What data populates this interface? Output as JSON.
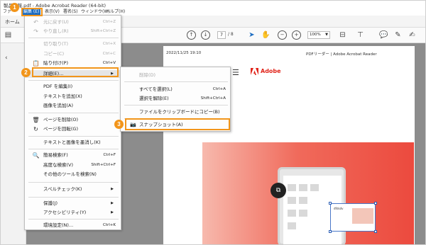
{
  "window": {
    "title": "製品情報.pdf - Adobe Acrobat Reader (64-bit)"
  },
  "menubar": {
    "items": [
      {
        "label": "ファ"
      },
      {
        "label": "編集 (E)"
      },
      {
        "label": "表示(V)"
      },
      {
        "label": "署名(S)"
      },
      {
        "label": "ウィンドウ(W)"
      },
      {
        "label": "ヘルプ(H)"
      }
    ]
  },
  "tabs": {
    "home": "ホーム"
  },
  "toolbar": {
    "page_current": "7",
    "page_total": "/ 8",
    "zoom": "100%"
  },
  "document": {
    "header_date": "2022/11/25 19:10",
    "header_title": "PDFリーダー | Adobe Acrobat Reader",
    "brand": "Adobe",
    "card_text": "dfdsdv"
  },
  "edit_menu": {
    "items": [
      {
        "label": "元に戻す(U)",
        "shortcut": "Ctrl+Z",
        "disabled": true,
        "icon": "undo-icon"
      },
      {
        "label": "やり直し(R)",
        "shortcut": "Shift+Ctrl+Z",
        "disabled": true,
        "icon": "redo-icon"
      },
      {
        "label": "切り取り(T)",
        "shortcut": "Ctrl+X",
        "disabled": true
      },
      {
        "label": "コピー(C)",
        "shortcut": "Ctrl+C",
        "disabled": true
      },
      {
        "label": "貼り付け(P)",
        "shortcut": "Ctrl+V",
        "disabled": false,
        "icon": "clipboard-icon"
      },
      {
        "label": "詳細(E)...",
        "shortcut": "",
        "disabled": false
      },
      {
        "label": "PDF を編集(I)",
        "shortcut": "",
        "disabled": false
      },
      {
        "label": "テキストを追加(X)",
        "shortcut": "",
        "disabled": false
      },
      {
        "label": "画像を追加(A)",
        "shortcut": "",
        "disabled": false
      },
      {
        "label": "ページを削除(O)",
        "shortcut": "",
        "disabled": false,
        "icon": "trash-icon"
      },
      {
        "label": "ページを回転(G)",
        "shortcut": "",
        "disabled": false,
        "icon": "rotate-icon"
      },
      {
        "label": "テキストと画像を墨消し(K)",
        "shortcut": "",
        "disabled": false
      },
      {
        "label": "簡易検索(F)",
        "shortcut": "Ctrl+F",
        "disabled": false,
        "icon": "search-icon"
      },
      {
        "label": "高度な検索(V)",
        "shortcut": "Shift+Ctrl+F",
        "disabled": false
      },
      {
        "label": "その他のツールを検索(N)",
        "shortcut": "",
        "disabled": false
      },
      {
        "label": "スペルチェック(K)",
        "shortcut": "",
        "disabled": false
      },
      {
        "label": "保護(J)",
        "shortcut": "",
        "disabled": false
      },
      {
        "label": "アクセシビリティ(Y)",
        "shortcut": "",
        "disabled": false
      },
      {
        "label": "環境設定(N)...",
        "shortcut": "Ctrl+K",
        "disabled": false
      }
    ]
  },
  "submenu": {
    "items": [
      {
        "label": "削除(D)",
        "shortcut": "",
        "disabled": true
      },
      {
        "label": "すべてを選択(L)",
        "shortcut": "Ctrl+A",
        "disabled": false
      },
      {
        "label": "選択を解除(E)",
        "shortcut": "Shift+Ctrl+A",
        "disabled": false
      },
      {
        "label": "ファイルをクリップボードにコピー(B)",
        "shortcut": "",
        "disabled": false
      },
      {
        "label": "スナップショット(A)",
        "shortcut": "",
        "disabled": false,
        "icon": "camera-icon"
      }
    ]
  },
  "steps": [
    "1",
    "2",
    "3"
  ],
  "colors": {
    "accent_orange": "#f2951a",
    "menu_highlight": "#1e6ec2",
    "adobe_red": "#e1251b"
  }
}
